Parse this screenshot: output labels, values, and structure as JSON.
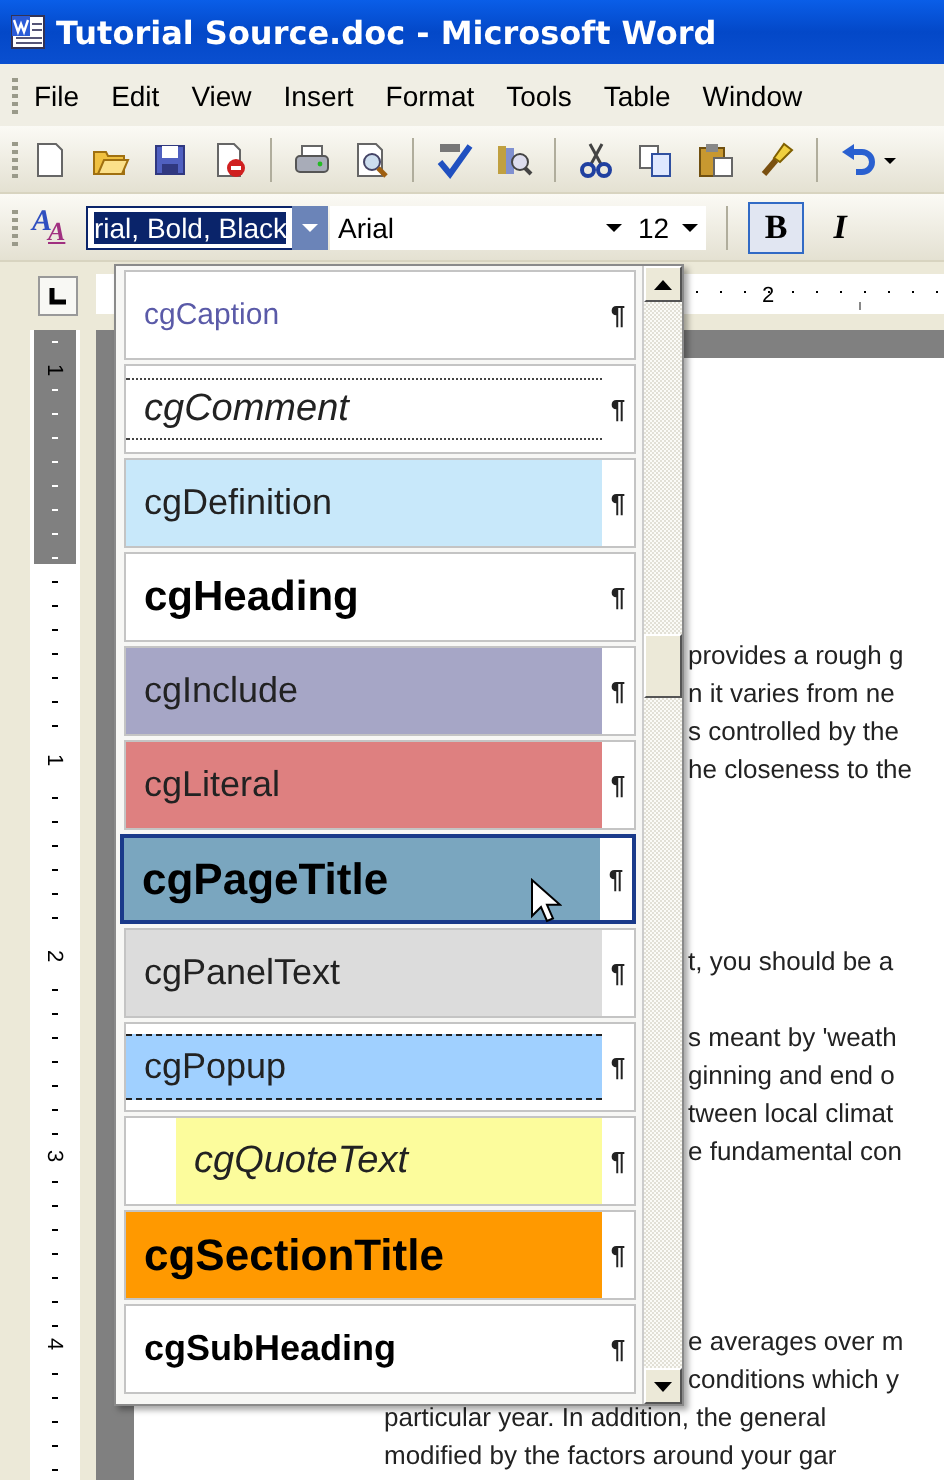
{
  "window": {
    "title": "Tutorial Source.doc - Microsoft Word"
  },
  "menu": [
    "File",
    "Edit",
    "View",
    "Insert",
    "Format",
    "Tools",
    "Table",
    "Window"
  ],
  "formatting_toolbar": {
    "styles_glyphs": [
      "A",
      "A"
    ],
    "style_value": "rial, Bold, Black",
    "font_value": "Arial",
    "size_value": "12",
    "buttons": [
      {
        "label": "B",
        "kind": "bold",
        "pressed": true
      },
      {
        "label": "I",
        "kind": "italic",
        "pressed": false
      }
    ]
  },
  "rulers": {
    "horizontal_numbers": [
      "2"
    ],
    "vertical_numbers": [
      "1",
      "1",
      "2",
      "3",
      "4"
    ]
  },
  "document": {
    "paragraphs": [
      {
        "lines": [
          {
            "text": "provides a rough g",
            "kind": "clipped"
          },
          {
            "text": "n it varies from ne",
            "kind": "clipped"
          },
          {
            "text": "s controlled by the",
            "kind": "clipped"
          },
          {
            "text": "he closeness to the",
            "kind": "clipped"
          }
        ]
      },
      {
        "lines": [
          {
            "text": "t, you should be a",
            "kind": "clipped"
          }
        ]
      },
      {
        "lines": [
          {
            "text": "s meant by 'weath",
            "kind": "clipped"
          },
          {
            "text": "ginning and end o",
            "kind": "clipped"
          },
          {
            "text": "tween local climat",
            "kind": "clipped"
          },
          {
            "text": "e fundamental con",
            "kind": "clipped"
          }
        ]
      },
      {
        "lines": [
          {
            "text": "e averages over m",
            "kind": "clipped"
          },
          {
            "text": "conditions which y",
            "kind": "clipped"
          },
          {
            "text": "particular year. In addition, the general",
            "kind": "full"
          },
          {
            "text": "modified by the factors around your gar",
            "kind": "full"
          }
        ]
      }
    ]
  },
  "style_list": {
    "items": [
      {
        "name": "cgCaption",
        "kind": "caption",
        "color": "#ffffff",
        "mark": "¶",
        "selected": false
      },
      {
        "name": "cgComment",
        "kind": "comment",
        "color": "#ffffff",
        "mark": "¶",
        "selected": false
      },
      {
        "name": "cgDefinition",
        "kind": "plain",
        "color": "#c8e8fa",
        "mark": "¶",
        "selected": false
      },
      {
        "name": "cgHeading",
        "kind": "heading",
        "color": "#ffffff",
        "mark": "¶",
        "selected": false
      },
      {
        "name": "cgInclude",
        "kind": "plain",
        "color": "#a6a6c6",
        "mark": "¶",
        "selected": false
      },
      {
        "name": "cgLiteral",
        "kind": "plain",
        "color": "#de8080",
        "mark": "¶",
        "selected": false
      },
      {
        "name": "cgPageTitle",
        "kind": "title",
        "color": "#7aa6bf",
        "mark": "¶",
        "selected": true
      },
      {
        "name": "cgPanelText",
        "kind": "plain",
        "color": "#dcdcdc",
        "mark": "¶",
        "selected": false
      },
      {
        "name": "cgPopup",
        "kind": "popup",
        "color": "#a0d0ff",
        "mark": "¶",
        "selected": false
      },
      {
        "name": "cgQuoteText",
        "kind": "quote",
        "color": "#fcfc9c",
        "mark": "¶",
        "selected": false
      },
      {
        "name": "cgSectionTitle",
        "kind": "title",
        "color": "#ff9900",
        "mark": "¶",
        "selected": false
      },
      {
        "name": "cgSubHeading",
        "kind": "subheading",
        "color": "#ffffff",
        "mark": "¶",
        "selected": false
      }
    ]
  }
}
